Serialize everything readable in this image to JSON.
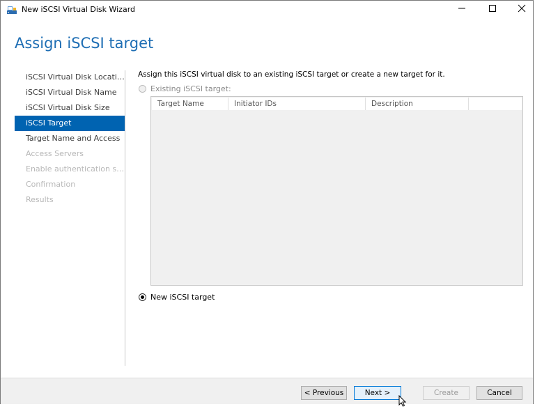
{
  "window": {
    "title": "New iSCSI Virtual Disk Wizard",
    "icon": "iscsi-wizard-icon",
    "controls": [
      "minimize-icon",
      "maximize-icon",
      "close-icon"
    ]
  },
  "header": {
    "title": "Assign iSCSI target"
  },
  "nav": {
    "items": [
      {
        "label": "iSCSI Virtual Disk Location",
        "state": "normal"
      },
      {
        "label": "iSCSI Virtual Disk Name",
        "state": "normal"
      },
      {
        "label": "iSCSI Virtual Disk Size",
        "state": "normal"
      },
      {
        "label": "iSCSI Target",
        "state": "active"
      },
      {
        "label": "Target Name and Access",
        "state": "normal"
      },
      {
        "label": "Access Servers",
        "state": "disabled"
      },
      {
        "label": "Enable authentication ser...",
        "state": "disabled"
      },
      {
        "label": "Confirmation",
        "state": "disabled"
      },
      {
        "label": "Results",
        "state": "disabled"
      }
    ]
  },
  "content": {
    "intro": "Assign this iSCSI virtual disk to an existing iSCSI target or create a new target for it.",
    "existing_option": {
      "label": "Existing iSCSI target:",
      "selected": false,
      "enabled": false
    },
    "new_option": {
      "label": "New iSCSI target",
      "selected": true,
      "enabled": true
    },
    "table": {
      "columns": [
        "Target Name",
        "Initiator IDs",
        "Description"
      ],
      "rows": []
    }
  },
  "footer": {
    "previous": "< Previous",
    "next": "Next >",
    "create": "Create",
    "cancel": "Cancel"
  },
  "colors": {
    "accent": "#0063b1",
    "title": "#1e6eb4",
    "disabled_text": "#b8b8b8"
  }
}
